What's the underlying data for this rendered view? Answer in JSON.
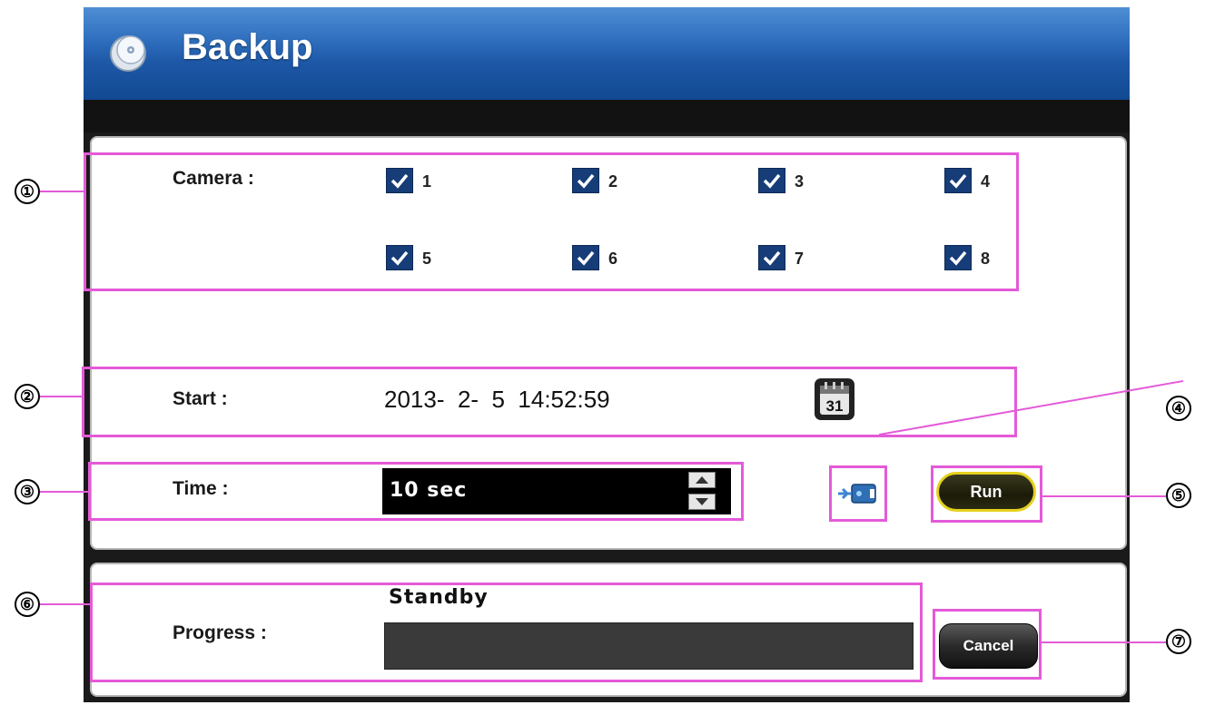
{
  "window": {
    "title": "Backup"
  },
  "camera": {
    "label": "Camera :",
    "channels": [
      {
        "num": "1",
        "checked": true
      },
      {
        "num": "2",
        "checked": true
      },
      {
        "num": "3",
        "checked": true
      },
      {
        "num": "4",
        "checked": true
      },
      {
        "num": "5",
        "checked": true
      },
      {
        "num": "6",
        "checked": true
      },
      {
        "num": "7",
        "checked": true
      },
      {
        "num": "8",
        "checked": true
      }
    ]
  },
  "start": {
    "label": "Start :",
    "value": "2013-  2-  5  14:52:59",
    "calendar_day": "31"
  },
  "time": {
    "label": "Time :",
    "value": "10 sec"
  },
  "run": {
    "label": "Run"
  },
  "progress": {
    "label": "Progress :",
    "status": "Standby",
    "value": 0
  },
  "cancel": {
    "label": "Cancel"
  },
  "callouts": [
    "①",
    "②",
    "③",
    "④",
    "⑤",
    "⑥",
    "⑦"
  ],
  "colors": {
    "titlebar": "#1d58a7",
    "highlight": "#e45ad8",
    "checkbox": "#163d78",
    "run_border": "#e5d11e"
  }
}
